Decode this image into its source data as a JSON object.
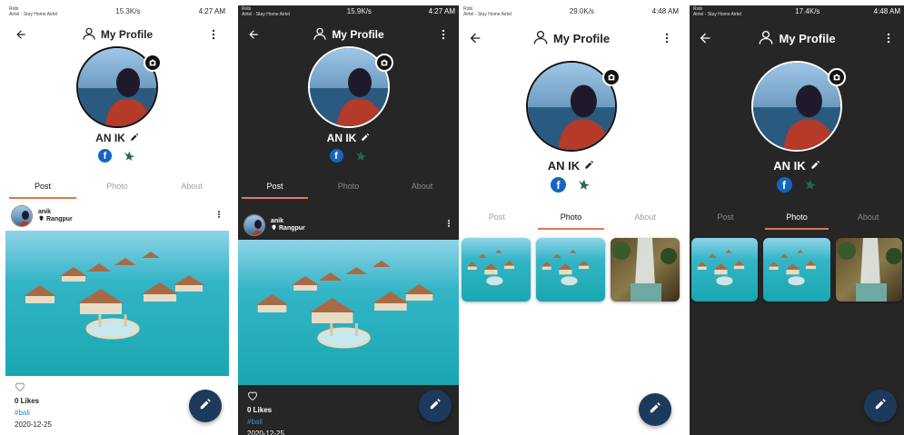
{
  "screens": [
    {
      "theme": "light",
      "status": {
        "carrier": [
          "Robi",
          "Airtel - Stay Home Airtel"
        ],
        "speed": "15.3K/s",
        "time": "4:27 AM"
      },
      "header": {
        "title": "My Profile"
      },
      "profile": {
        "name": "AN IK"
      },
      "tabs": [
        "Post",
        "Photo",
        "About"
      ],
      "active_tab": "Post",
      "post": {
        "username": "anik",
        "location": "Rangpur",
        "likes": "0 Likes",
        "tag": "#bali",
        "date": "2020-12-25"
      }
    },
    {
      "theme": "dark",
      "status": {
        "carrier": [
          "Robi",
          "Airtel - Stay Home Airtel"
        ],
        "speed": "15.9K/s",
        "time": "4:27 AM"
      },
      "header": {
        "title": "My Profile"
      },
      "profile": {
        "name": "AN IK"
      },
      "tabs": [
        "Post",
        "Photo",
        "About"
      ],
      "active_tab": "Post",
      "post": {
        "username": "anik",
        "location": "Rangpur",
        "likes": "0 Likes",
        "tag": "#bali",
        "date": "2020-12-25"
      }
    },
    {
      "theme": "light",
      "status": {
        "carrier": [
          "Robi",
          "Airtel - Stay Home Airtel"
        ],
        "speed": "29.0K/s",
        "time": "4:48 AM"
      },
      "header": {
        "title": "My Profile"
      },
      "profile": {
        "name": "AN IK"
      },
      "tabs": [
        "Post",
        "Photo",
        "About"
      ],
      "active_tab": "Photo"
    },
    {
      "theme": "dark",
      "status": {
        "carrier": [
          "Robi",
          "Airtel - Stay Home Airtel"
        ],
        "speed": "17.4K/s",
        "time": "4:48 AM"
      },
      "header": {
        "title": "My Profile"
      },
      "profile": {
        "name": "AN IK"
      },
      "tabs": [
        "Post",
        "Photo",
        "About"
      ],
      "active_tab": "Photo"
    }
  ],
  "colors": {
    "accent_underline": "#e0784e",
    "fab": "#1d3a5c",
    "hashtag": "#3a86c8",
    "facebook": "#1565c0",
    "dark_bg": "#262626"
  },
  "icons": [
    "back-arrow-icon",
    "user-outline-icon",
    "more-vert-icon",
    "camera-icon",
    "pencil-icon",
    "facebook-icon",
    "bird-icon",
    "location-pin-icon",
    "heart-outline-icon",
    "edit-fab-icon"
  ]
}
